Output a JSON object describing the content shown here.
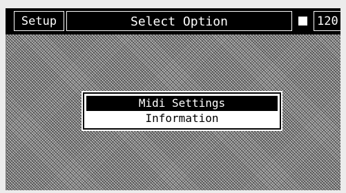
{
  "header": {
    "left_label": "Setup",
    "title": "Select Option",
    "indicator_icon": "filled-square",
    "tempo": "120"
  },
  "menu": {
    "items": [
      {
        "label": "Midi Settings",
        "selected": true
      },
      {
        "label": "Information",
        "selected": false
      }
    ]
  },
  "colors": {
    "foreground": "#000000",
    "background": "#ffffff",
    "screen_pattern": "#b4b4b4"
  }
}
